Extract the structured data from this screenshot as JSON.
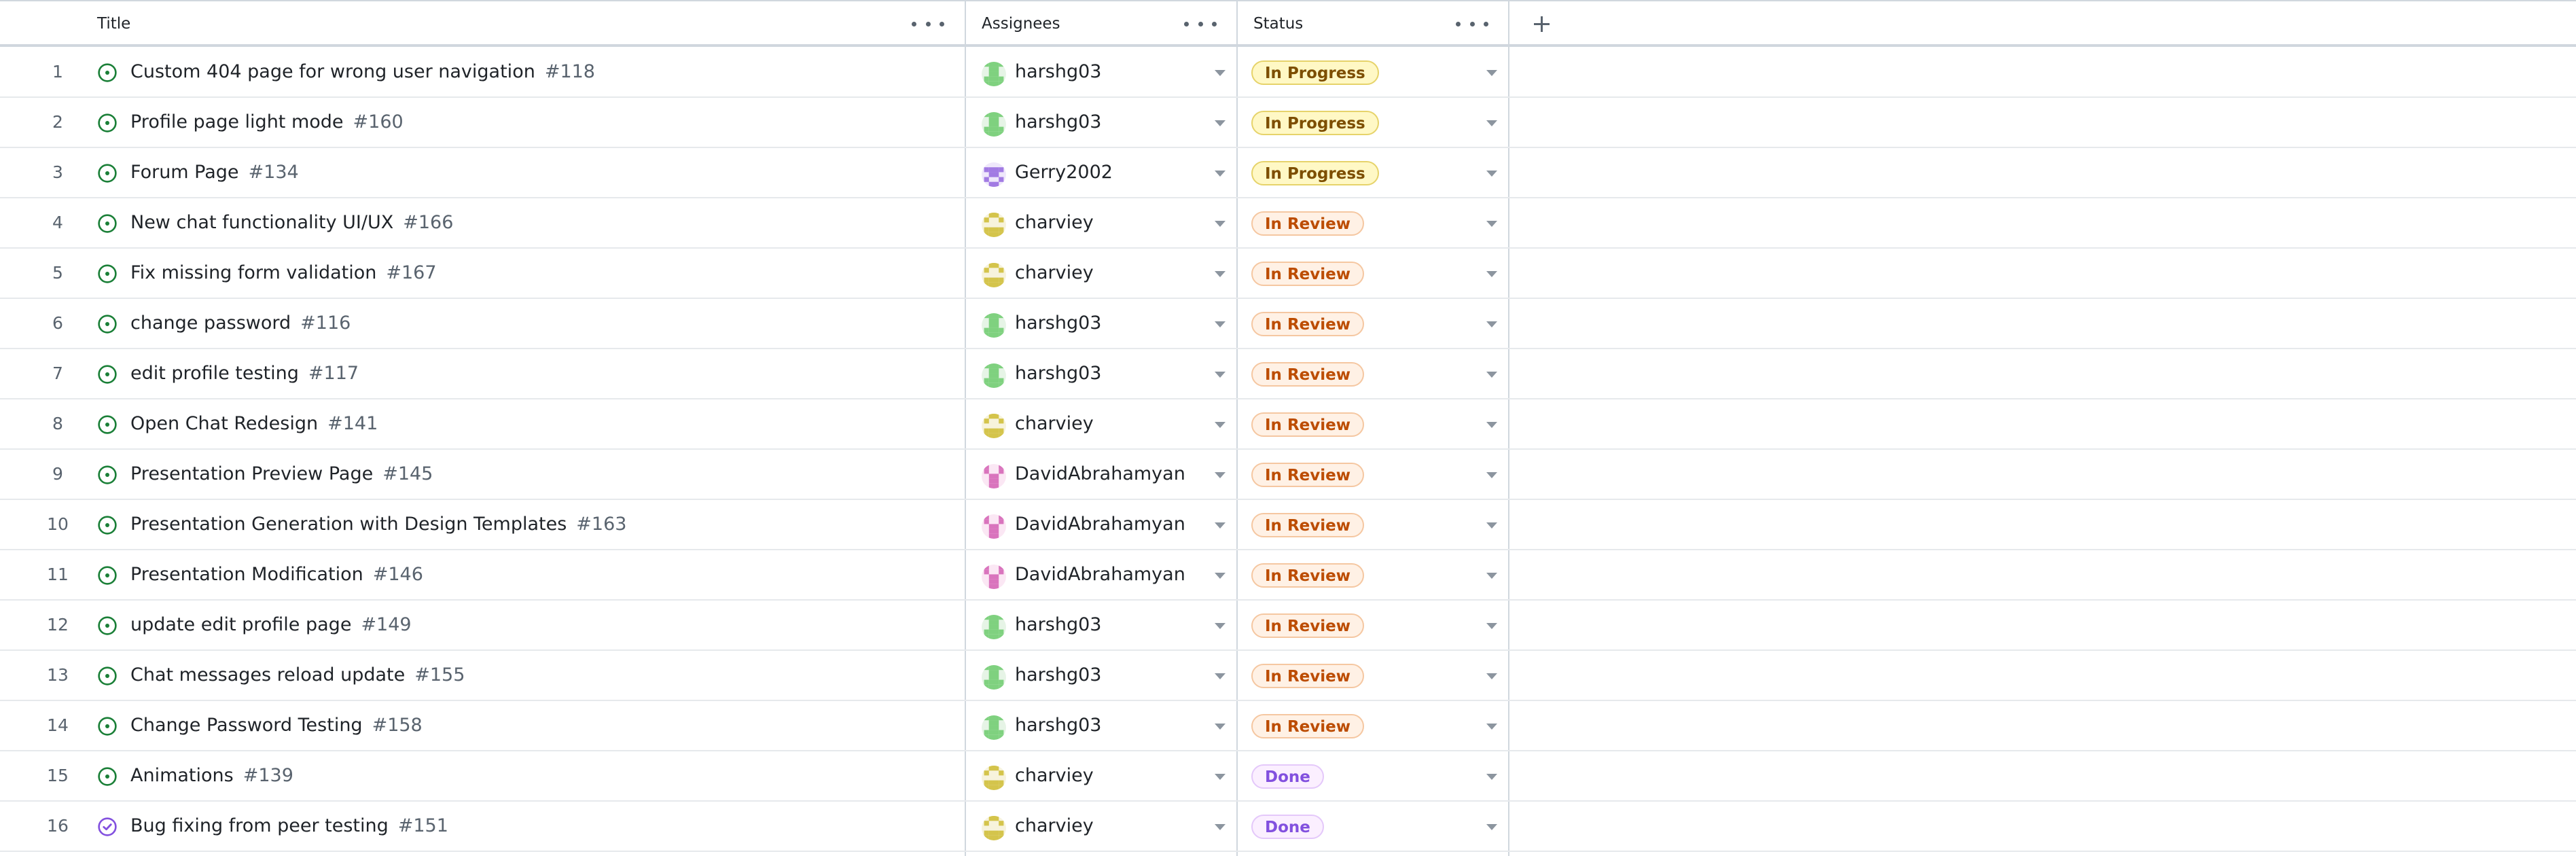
{
  "columns": {
    "title": "Title",
    "assignees": "Assignees",
    "status": "Status"
  },
  "icons": {
    "open_issue": "issue-opened-icon",
    "closed_issue": "issue-closed-icon",
    "add_field": "plus-icon",
    "column_menu": "kebab-horizontal-icon",
    "dropdown": "triangle-down-icon"
  },
  "status_styles": {
    "In Progress": {
      "bg": "#fff8c5",
      "fg": "#7d4e00",
      "border": "#e6d36a"
    },
    "In Review": {
      "bg": "#fff1e5",
      "fg": "#bc4c00",
      "border": "#f5c7a1"
    },
    "Done": {
      "bg": "#fbefff",
      "fg": "#8250df",
      "border": "#e4c8fa"
    }
  },
  "avatar_colors": {
    "harshg03": {
      "bg": "#e6f4e6",
      "fg": "#7fd17f"
    },
    "Gerry2002": {
      "bg": "#efe8fb",
      "fg": "#a27be3"
    },
    "charviey": {
      "bg": "#f7f3dc",
      "fg": "#d4c44b"
    },
    "DavidAbrahamyan": {
      "bg": "#fbe7f4",
      "fg": "#d974bd"
    }
  },
  "rows": [
    {
      "num": "1",
      "title": "Custom 404 page for wrong user navigation",
      "issue": "#118",
      "assignee": "harshg03",
      "status": "In Progress",
      "state": "open"
    },
    {
      "num": "2",
      "title": "Profile page light mode",
      "issue": "#160",
      "assignee": "harshg03",
      "status": "In Progress",
      "state": "open"
    },
    {
      "num": "3",
      "title": "Forum Page",
      "issue": "#134",
      "assignee": "Gerry2002",
      "status": "In Progress",
      "state": "open"
    },
    {
      "num": "4",
      "title": "New chat functionality UI/UX",
      "issue": "#166",
      "assignee": "charviey",
      "status": "In Review",
      "state": "open"
    },
    {
      "num": "5",
      "title": "Fix missing form validation",
      "issue": "#167",
      "assignee": "charviey",
      "status": "In Review",
      "state": "open"
    },
    {
      "num": "6",
      "title": "change password",
      "issue": "#116",
      "assignee": "harshg03",
      "status": "In Review",
      "state": "open"
    },
    {
      "num": "7",
      "title": "edit profile testing",
      "issue": "#117",
      "assignee": "harshg03",
      "status": "In Review",
      "state": "open"
    },
    {
      "num": "8",
      "title": "Open Chat Redesign",
      "issue": "#141",
      "assignee": "charviey",
      "status": "In Review",
      "state": "open"
    },
    {
      "num": "9",
      "title": "Presentation Preview Page",
      "issue": "#145",
      "assignee": "DavidAbrahamyan",
      "status": "In Review",
      "state": "open"
    },
    {
      "num": "10",
      "title": "Presentation Generation with Design Templates",
      "issue": "#163",
      "assignee": "DavidAbrahamyan",
      "status": "In Review",
      "state": "open"
    },
    {
      "num": "11",
      "title": "Presentation Modification",
      "issue": "#146",
      "assignee": "DavidAbrahamyan",
      "status": "In Review",
      "state": "open"
    },
    {
      "num": "12",
      "title": "update edit profile page",
      "issue": "#149",
      "assignee": "harshg03",
      "status": "In Review",
      "state": "open"
    },
    {
      "num": "13",
      "title": "Chat messages reload update",
      "issue": "#155",
      "assignee": "harshg03",
      "status": "In Review",
      "state": "open"
    },
    {
      "num": "14",
      "title": "Change Password Testing",
      "issue": "#158",
      "assignee": "harshg03",
      "status": "In Review",
      "state": "open"
    },
    {
      "num": "15",
      "title": "Animations",
      "issue": "#139",
      "assignee": "charviey",
      "status": "Done",
      "state": "open"
    },
    {
      "num": "16",
      "title": "Bug fixing from peer testing",
      "issue": "#151",
      "assignee": "charviey",
      "status": "Done",
      "state": "closed"
    }
  ]
}
